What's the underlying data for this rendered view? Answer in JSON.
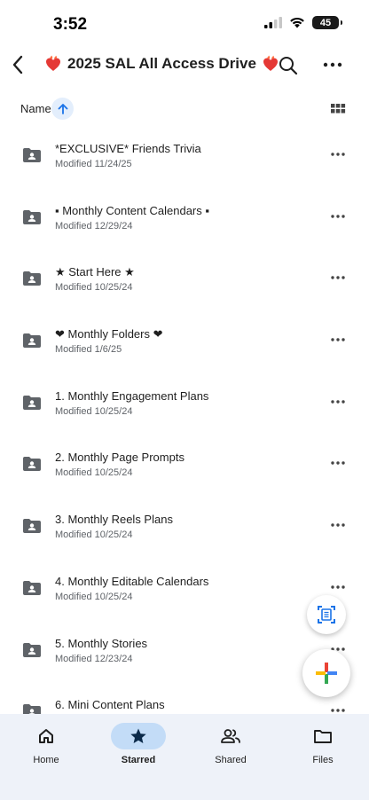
{
  "status_bar": {
    "time": "3:52",
    "battery": "45"
  },
  "header": {
    "title": "2025 SAL All Access Drive",
    "title_prefix_icon": "heart-on-fire-icon",
    "title_suffix_icon": "heart-on-fire-icon"
  },
  "sort": {
    "label": "Name",
    "direction": "ascending"
  },
  "files": [
    {
      "name": "*EXCLUSIVE* Friends Trivia",
      "modified": "Modified 11/24/25"
    },
    {
      "name": "▪ Monthly Content Calendars ▪",
      "modified": "Modified 12/29/24"
    },
    {
      "name": "★ Start Here ★",
      "modified": "Modified 10/25/24"
    },
    {
      "name": "❤ Monthly Folders ❤",
      "modified": "Modified 1/6/25"
    },
    {
      "name": "1. Monthly Engagement Plans",
      "modified": "Modified 10/25/24"
    },
    {
      "name": "2. Monthly Page Prompts",
      "modified": "Modified 10/25/24"
    },
    {
      "name": "3. Monthly Reels Plans",
      "modified": "Modified 10/25/24"
    },
    {
      "name": "4. Monthly Editable Calendars",
      "modified": "Modified 10/25/24"
    },
    {
      "name": "5. Monthly Stories",
      "modified": "Modified 12/23/24"
    },
    {
      "name": "6. Mini Content Plans",
      "modified": ""
    }
  ],
  "bottom_nav": [
    {
      "label": "Home",
      "icon": "home-icon",
      "active": false
    },
    {
      "label": "Starred",
      "icon": "star-icon",
      "active": true
    },
    {
      "label": "Shared",
      "icon": "people-icon",
      "active": false
    },
    {
      "label": "Files",
      "icon": "folder-icon",
      "active": false
    }
  ],
  "colors": {
    "accent": "#1a73e8",
    "nav_bg": "#eef2f9",
    "active_pill": "#c3dcf7",
    "icon_gray": "#5f6368"
  }
}
